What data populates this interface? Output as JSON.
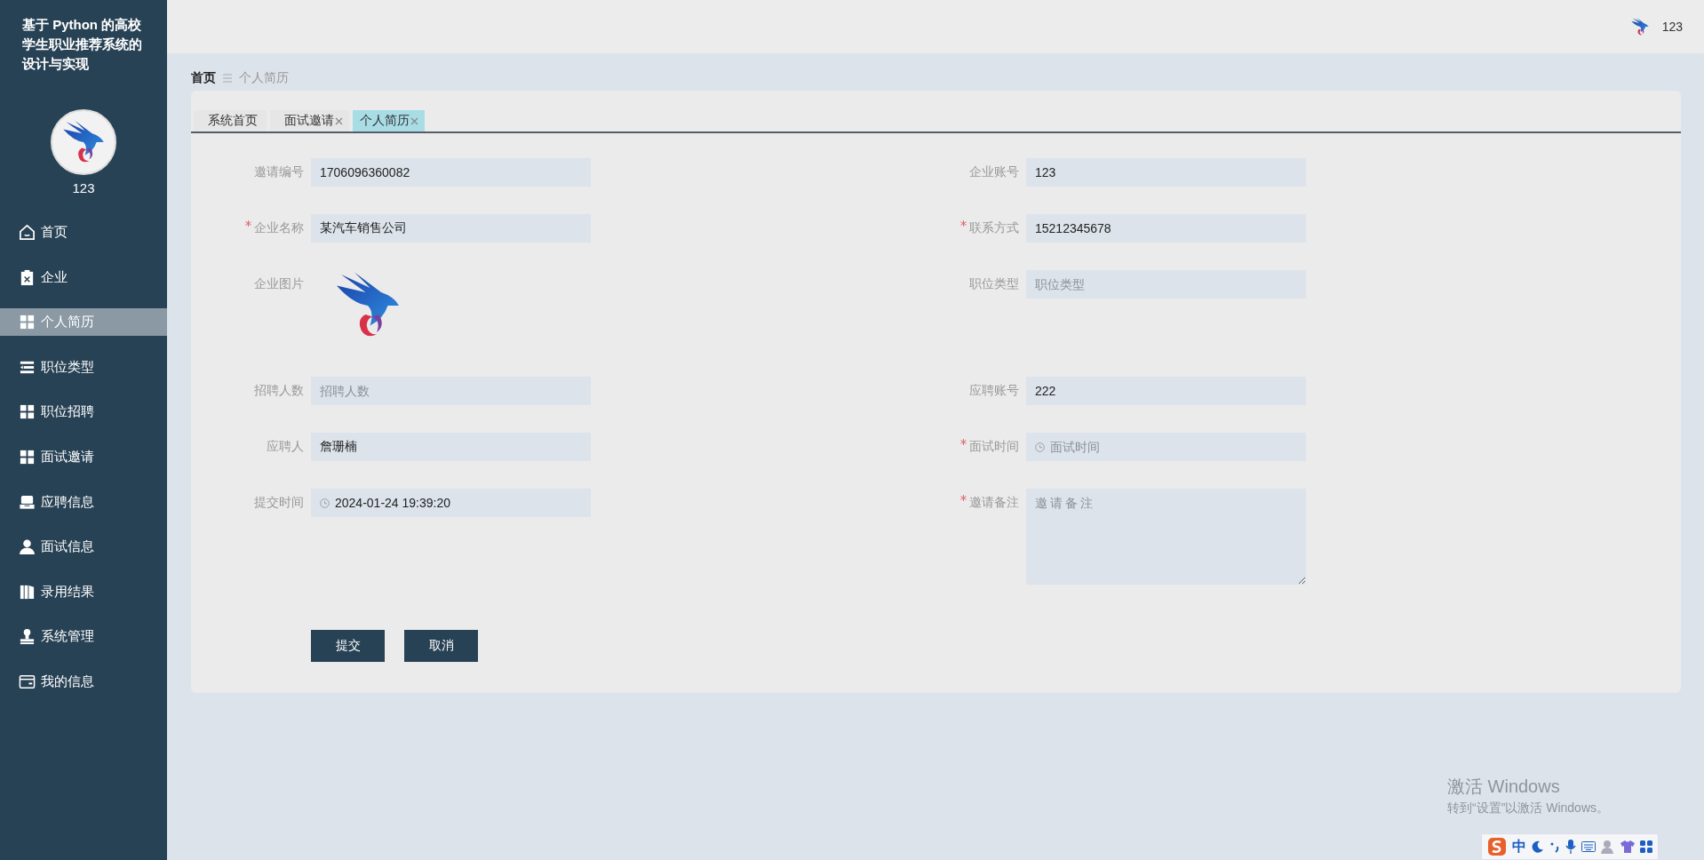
{
  "sidebar": {
    "title": "基于 Python 的高校学生职业推荐系统的设计与实现",
    "user": "123",
    "items": [
      {
        "label": "首页",
        "kind": "home",
        "selected": false
      },
      {
        "label": "企业",
        "kind": "clipboard",
        "selected": false
      },
      {
        "label": "个人简历",
        "kind": "grid",
        "selected": true
      },
      {
        "label": "职位类型",
        "kind": "list",
        "selected": false
      },
      {
        "label": "职位招聘",
        "kind": "grid",
        "selected": false
      },
      {
        "label": "面试邀请",
        "kind": "grid",
        "selected": false
      },
      {
        "label": "应聘信息",
        "kind": "inbox",
        "selected": false
      },
      {
        "label": "面试信息",
        "kind": "user",
        "selected": false
      },
      {
        "label": "录用结果",
        "kind": "book",
        "selected": false
      },
      {
        "label": "系统管理",
        "kind": "stamp",
        "selected": false
      },
      {
        "label": "我的信息",
        "kind": "card",
        "selected": false
      }
    ]
  },
  "header": {
    "user": "123"
  },
  "breadcrumb": [
    "首页",
    "个人简历"
  ],
  "tabs": [
    {
      "label": "系统首页",
      "selected": false,
      "closable": false
    },
    {
      "label": "面试邀请",
      "selected": false,
      "closable": true
    },
    {
      "label": "个人简历",
      "selected": true,
      "closable": true
    }
  ],
  "form": {
    "rows": [
      {
        "left": {
          "label": "邀请编号",
          "required": false,
          "kind": "text",
          "value": "1706096360082"
        },
        "right": {
          "label": "企业账号",
          "required": false,
          "kind": "text",
          "value": "123"
        }
      },
      {
        "left": {
          "label": "企业名称",
          "required": true,
          "kind": "text",
          "value": "某汽车销售公司"
        },
        "right": {
          "label": "联系方式",
          "required": true,
          "kind": "text",
          "value": "15212345678"
        }
      },
      {
        "left": {
          "label": "企业图片",
          "required": false,
          "kind": "image"
        },
        "right": {
          "label": "职位类型",
          "required": false,
          "kind": "text",
          "placeholder": "职位类型"
        }
      },
      {
        "left": {
          "label": "招聘人数",
          "required": false,
          "kind": "text",
          "placeholder": "招聘人数"
        },
        "right": {
          "label": "应聘账号",
          "required": false,
          "kind": "text",
          "value": "222"
        }
      },
      {
        "left": {
          "label": "应聘人",
          "required": false,
          "kind": "text",
          "value": "詹珊楠"
        },
        "right": {
          "label": "面试时间",
          "required": true,
          "kind": "date",
          "placeholder": "面试时间"
        }
      },
      {
        "left": {
          "label": "提交时间",
          "required": false,
          "kind": "date",
          "value": "2024-01-24 19:39:20"
        },
        "right": {
          "label": "邀请备注",
          "required": true,
          "kind": "textarea",
          "placeholder": "邀请备注"
        }
      }
    ],
    "buttons": [
      "提交",
      "取消"
    ]
  },
  "system": {
    "activation_title": "激活 Windows",
    "activation_hint": "转到“设置”以激活 Windows。",
    "ime_mode": "中"
  }
}
